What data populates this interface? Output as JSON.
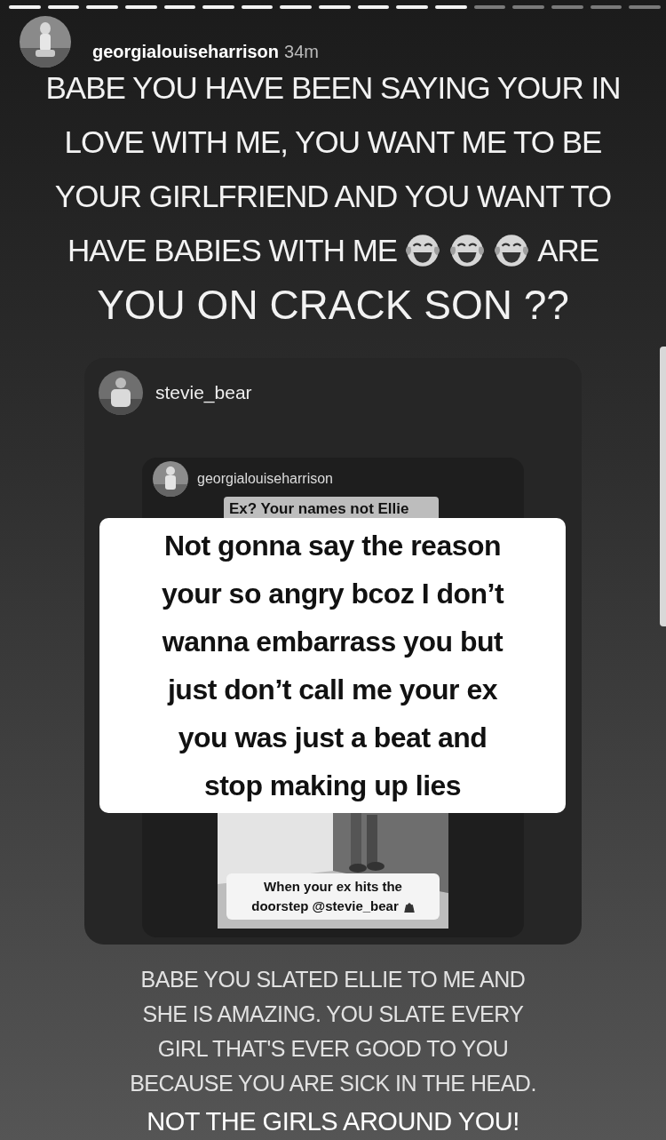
{
  "progress": [
    {
      "viewed": true
    },
    {
      "viewed": true
    },
    {
      "viewed": true
    },
    {
      "viewed": true
    },
    {
      "viewed": true
    },
    {
      "viewed": true
    },
    {
      "viewed": true
    },
    {
      "viewed": true
    },
    {
      "viewed": true
    },
    {
      "viewed": true
    },
    {
      "viewed": true
    },
    {
      "viewed": true
    },
    {
      "viewed": false
    },
    {
      "viewed": false
    },
    {
      "viewed": false
    },
    {
      "viewed": false
    },
    {
      "viewed": false
    }
  ],
  "header": {
    "username": "georgialouiseharrison",
    "time": "34m"
  },
  "caption": [
    [
      {
        "kind": "text",
        "text": "BABE YOU HAVE BEEN SAYING YOUR IN"
      }
    ],
    [
      {
        "kind": "text",
        "text": "LOVE WITH ME, YOU WANT ME TO BE"
      }
    ],
    [
      {
        "kind": "text",
        "text": "YOUR GIRLFRIEND AND YOU WANT TO"
      }
    ],
    [
      {
        "kind": "text",
        "text": "HAVE BABIES WITH ME"
      },
      {
        "kind": "emoji"
      },
      {
        "kind": "emoji"
      },
      {
        "kind": "emoji"
      },
      {
        "kind": "text",
        "text": "ARE"
      }
    ],
    [
      {
        "kind": "big",
        "text": "YOU ON CRACK SON ??"
      }
    ]
  ],
  "shared_story": {
    "username": "stevie_bear",
    "reply": {
      "username": "georgialouiseharrison",
      "question": "Ex? Your names not Ellie",
      "sticker": [
        {
          "kind": "text",
          "text": "When your ex hits the"
        },
        {
          "kind": "text",
          "text": "doorstep @stevie_bear"
        },
        {
          "kind": "icon"
        }
      ]
    },
    "note": [
      "Not gonna say the reason",
      "your so angry bcoz I don’t",
      "wanna embarrass you but",
      "just don’t call me your ex",
      "you was just a beat and",
      "stop making up lies"
    ]
  },
  "footer": [
    {
      "kind": "small",
      "text": "BABE YOU SLATED ELLIE TO ME AND"
    },
    {
      "kind": "small",
      "text": "SHE IS AMAZING. YOU SLATE EVERY"
    },
    {
      "kind": "small",
      "text": "GIRL THAT'S EVER GOOD TO YOU"
    },
    {
      "kind": "small",
      "text": "BECAUSE YOU ARE SICK IN THE HEAD."
    },
    {
      "kind": "big",
      "text": "NOT THE GIRLS AROUND YOU!"
    }
  ]
}
